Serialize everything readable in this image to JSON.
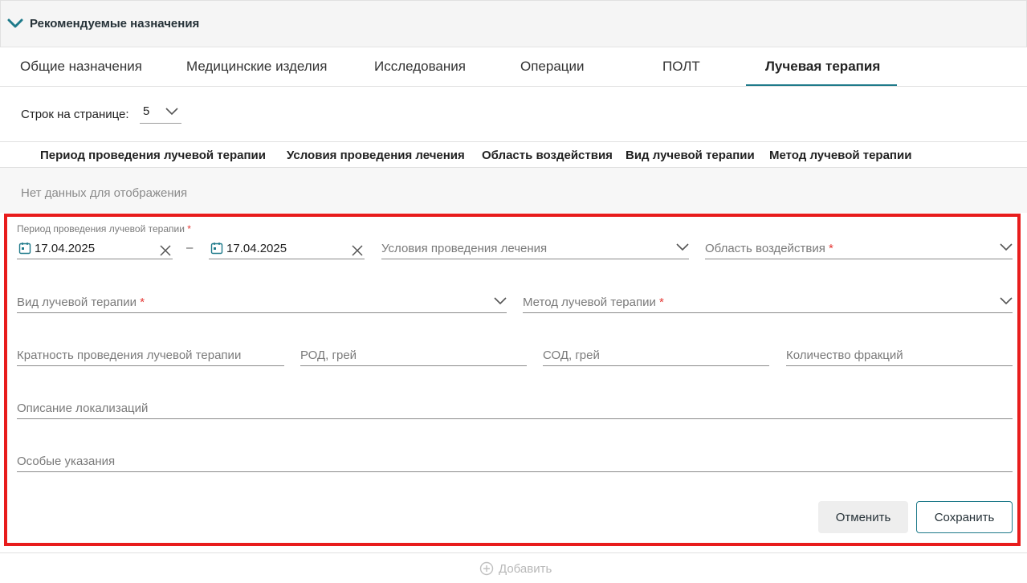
{
  "panel": {
    "title": "Рекомендуемые назначения",
    "expanded": true
  },
  "tabs": [
    {
      "label": "Общие назначения"
    },
    {
      "label": "Медицинские изделия"
    },
    {
      "label": "Исследования"
    },
    {
      "label": "Операции"
    },
    {
      "label": "ПОЛТ"
    },
    {
      "label": "Лучевая терапия",
      "active": true
    }
  ],
  "pagination": {
    "rows_label": "Строк на странице:",
    "rows_value": "5"
  },
  "table": {
    "columns": [
      "Период проведения лучевой терапии",
      "Условия проведения лечения",
      "Область воздействия",
      "Вид лучевой терапии",
      "Метод лучевой терапии"
    ],
    "empty_text": "Нет данных для отображения"
  },
  "form": {
    "period_label": "Период проведения лучевой терапии",
    "required_mark": "*",
    "date_from": "17.04.2025",
    "date_separator": "–",
    "date_to": "17.04.2025",
    "conditions_label": "Условия проведения лечения",
    "area_label": "Область воздействия",
    "therapy_type_label": "Вид лучевой терапии",
    "therapy_method_label": "Метод лучевой терапии",
    "frequency_label": "Кратность проведения лучевой терапии",
    "rod_label": "РОД, грей",
    "sod_label": "СОД, грей",
    "fractions_label": "Количество фракций",
    "localization_label": "Описание локализаций",
    "special_label": "Особые указания",
    "cancel_label": "Отменить",
    "save_label": "Сохранить"
  },
  "footer": {
    "add_label": "Добавить"
  },
  "colors": {
    "accent": "#1e7a8a",
    "highlight_border": "#e81c1c",
    "required": "#e53935"
  },
  "icons": [
    "chevron-down-icon",
    "calendar-icon",
    "clear-icon",
    "plus-circle-icon"
  ]
}
